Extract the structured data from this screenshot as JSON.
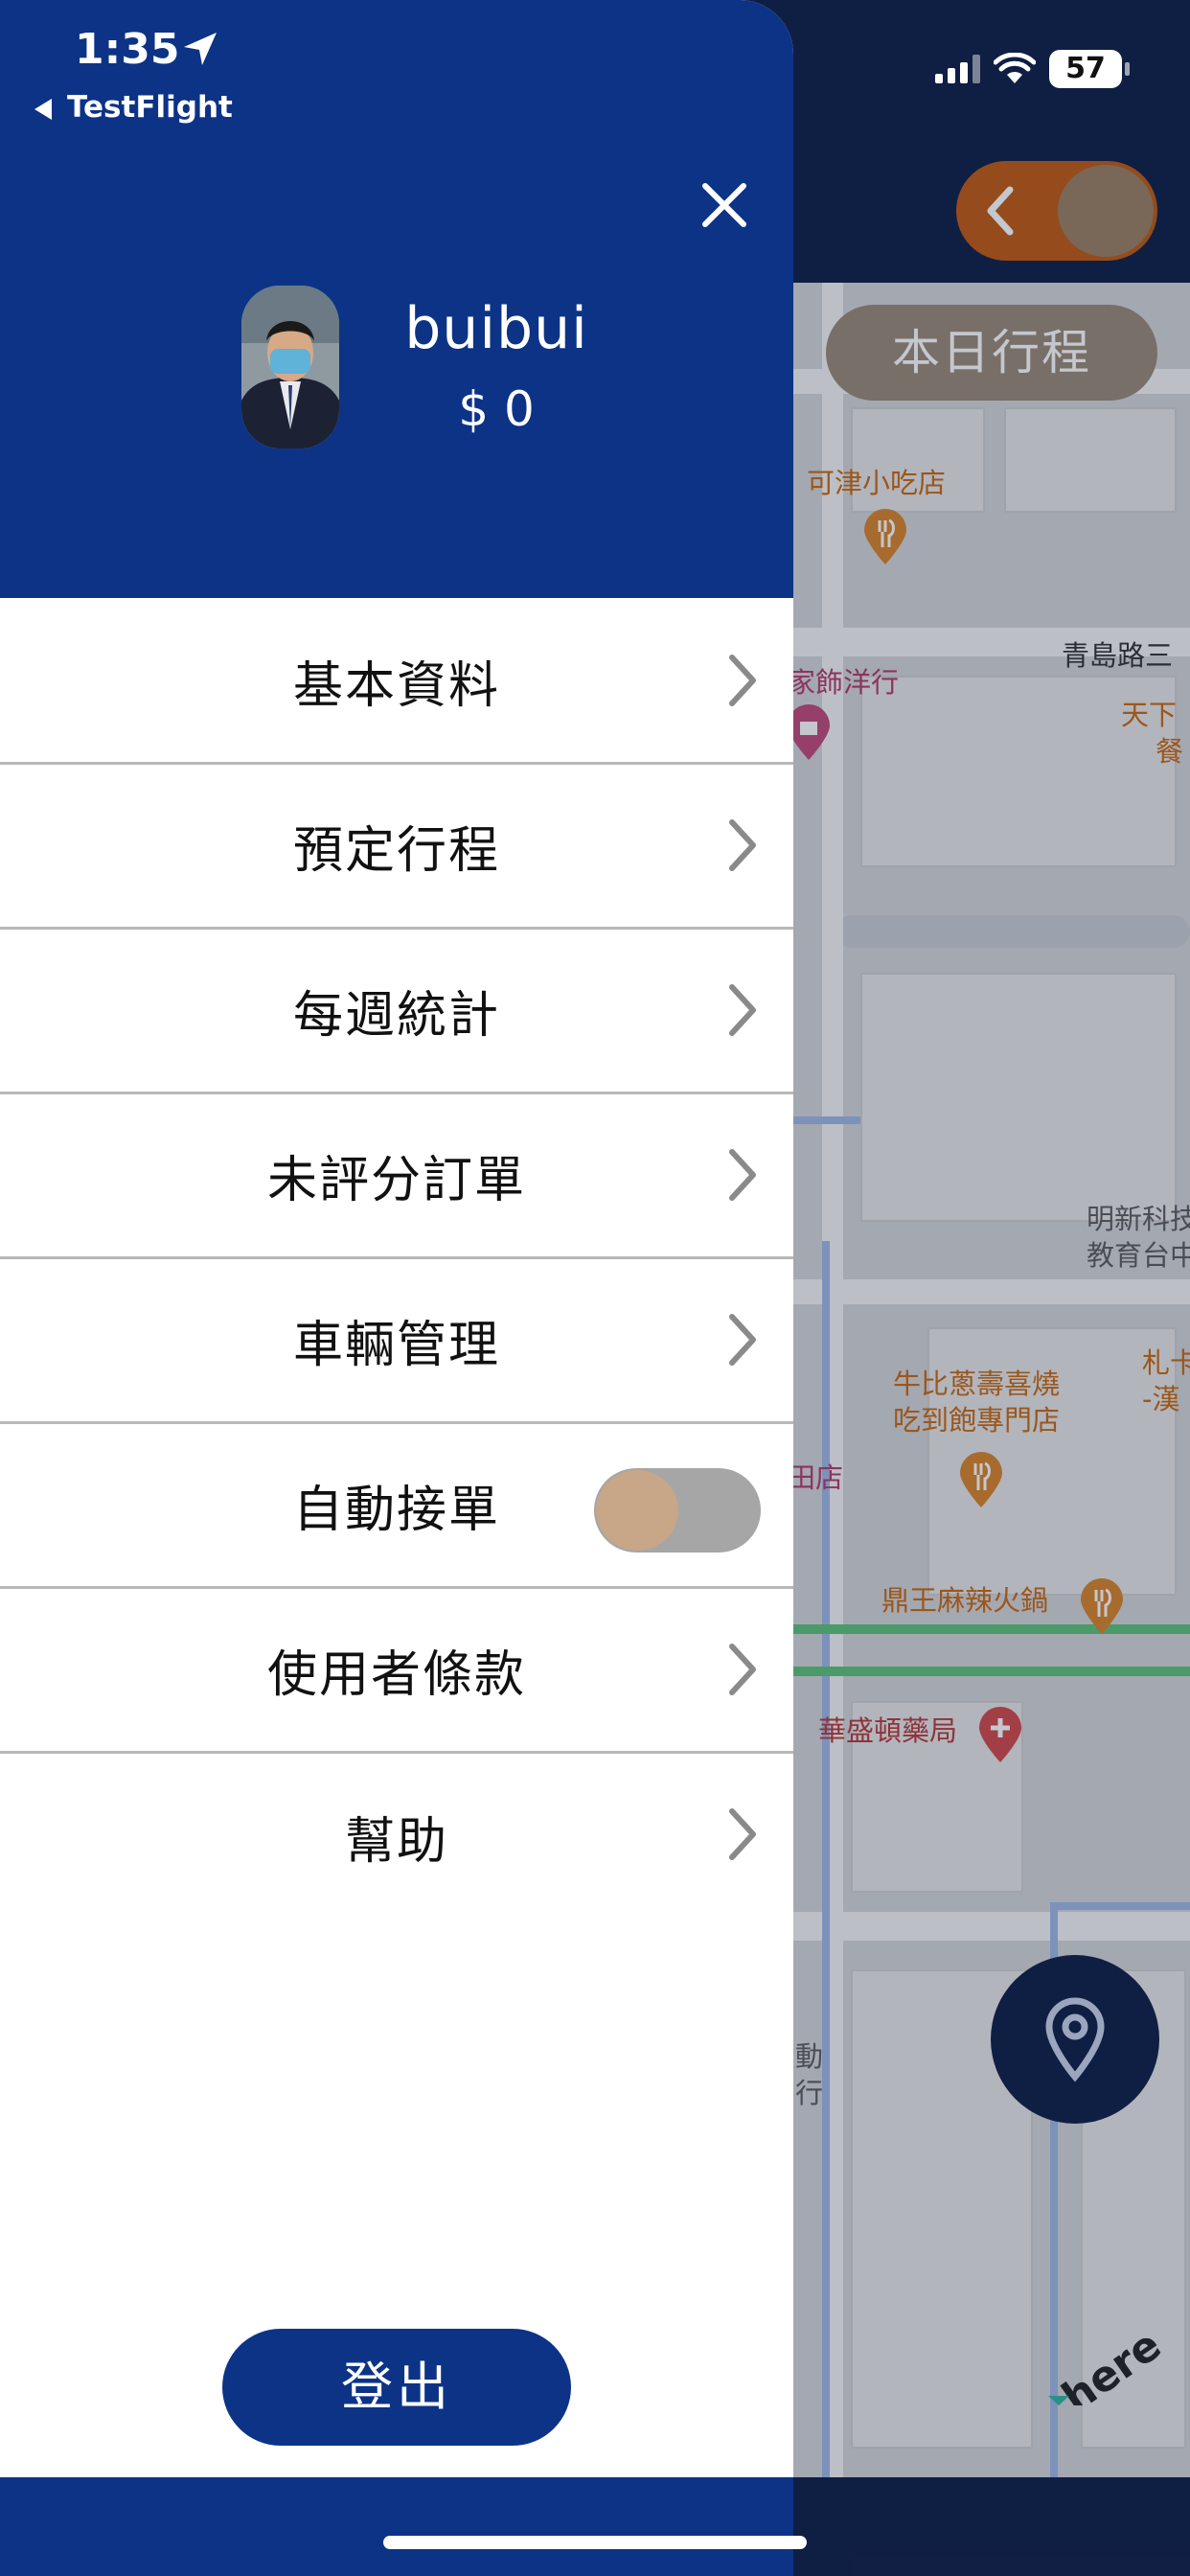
{
  "status_bar": {
    "time": "1:35",
    "back_app": "TestFlight",
    "battery": "57"
  },
  "background": {
    "trip_button": "本日行程",
    "map_labels": {
      "l1": "可津小吃店",
      "l2": "青島路三",
      "l3": "家飾洋行",
      "l4": "天下",
      "l5": "餐",
      "l6": "明新科技",
      "l7": "教育台中",
      "l8": "牛比蔥壽喜燒",
      "l9": "吃到飽專門店",
      "l10": "札卡",
      "l11": "-漢",
      "l12": "田店",
      "l13": "鼎王麻辣火鍋",
      "l14": "華盛頓藥局",
      "l15": "動",
      "l16": "行"
    },
    "colors": {
      "accent_orange": "#c05a12",
      "map_bg": "#d4d6d8"
    }
  },
  "drawer": {
    "username": "buibui",
    "balance": "$ 0",
    "menu": [
      {
        "label": "基本資料",
        "type": "link"
      },
      {
        "label": "預定行程",
        "type": "link"
      },
      {
        "label": "每週統計",
        "type": "link"
      },
      {
        "label": "未評分訂單",
        "type": "link"
      },
      {
        "label": "車輛管理",
        "type": "link"
      },
      {
        "label": "自動接單",
        "type": "toggle",
        "on": false
      },
      {
        "label": "使用者條款",
        "type": "link"
      },
      {
        "label": "幫助",
        "type": "link"
      }
    ],
    "logout": "登出",
    "colors": {
      "primary": "#0d3387",
      "toggle_off": "#a6a6a6"
    }
  }
}
